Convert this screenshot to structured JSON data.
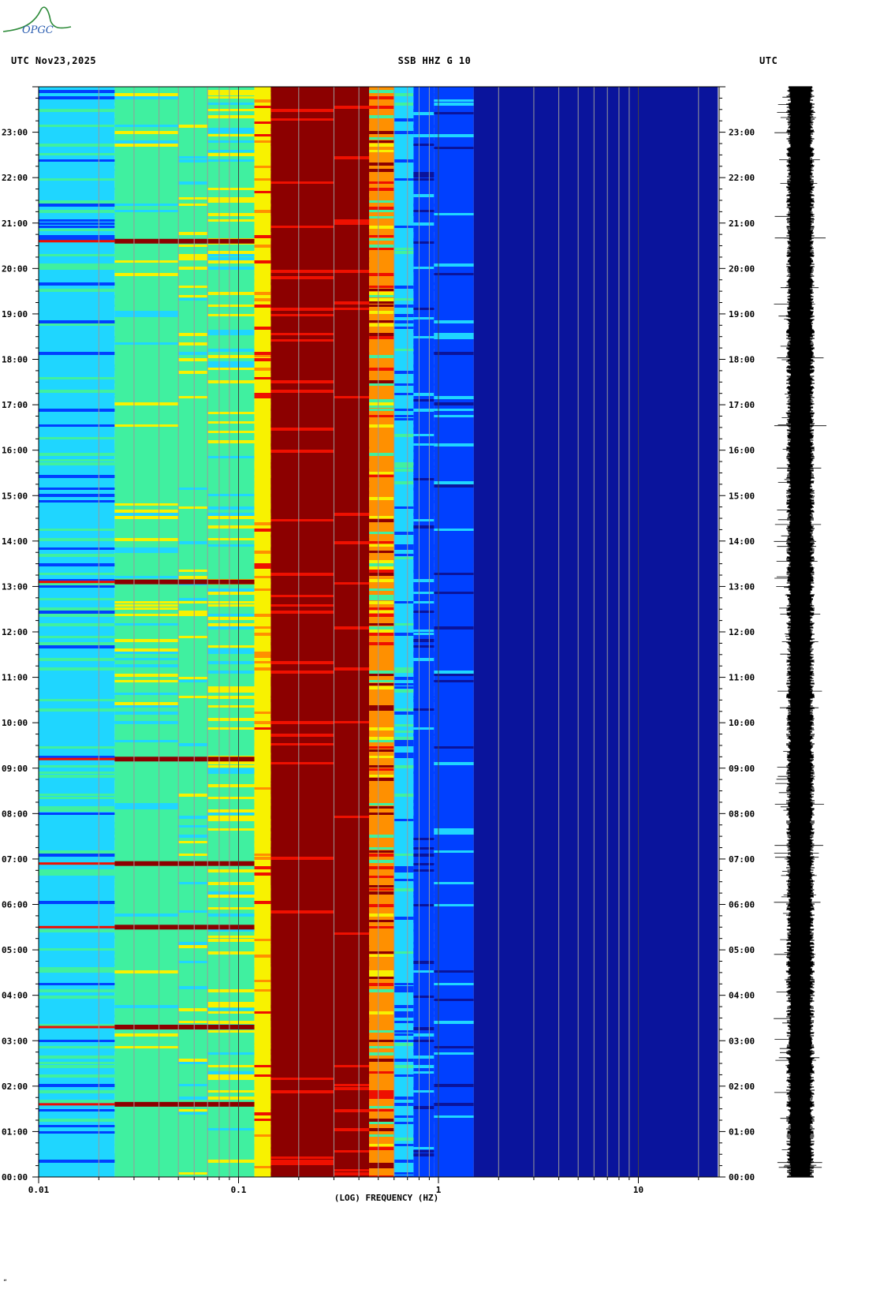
{
  "header": {
    "left": "UTC  Nov23,2025",
    "center": "SSB HHZ G 10",
    "right": "UTC"
  },
  "logo_text": "OPGC",
  "corner_mark": "„",
  "colors": {
    "deep_blue": "#0a149c",
    "blue": "#0040ff",
    "cyan": "#1fd6ff",
    "green": "#40f0a0",
    "yellow": "#f8f200",
    "orange": "#ff9000",
    "red": "#ee1000",
    "dark_red": "#8c0000"
  },
  "chart_data": {
    "type": "heatmap",
    "title": "SSB HHZ G 10",
    "xlabel": "(LOG) FREQUENCY (HZ)",
    "ylabel": "UTC",
    "x_scale": "log",
    "xlim": [
      0.01,
      25
    ],
    "x_ticks": [
      0.01,
      0.1,
      1,
      10
    ],
    "x_tick_labels": [
      "0.01",
      "0.1",
      "1",
      "10"
    ],
    "y_tick_labels": [
      "00:00",
      "01:00",
      "02:00",
      "03:00",
      "04:00",
      "05:00",
      "06:00",
      "07:00",
      "08:00",
      "09:00",
      "10:00",
      "11:00",
      "12:00",
      "13:00",
      "14:00",
      "15:00",
      "16:00",
      "17:00",
      "18:00",
      "19:00",
      "20:00",
      "21:00",
      "22:00",
      "23:00"
    ],
    "ylim_hours": [
      0,
      24
    ],
    "frequency_bands_hz": [
      0.01,
      0.024,
      0.05,
      0.07,
      0.12,
      0.145,
      0.3,
      0.45,
      0.6,
      0.75,
      0.95,
      1.5,
      25
    ],
    "band_levels": [
      "cyan-green",
      "green-yellow",
      "green-yellow",
      "yellow-green",
      "yellow-red",
      "dark-red",
      "dark-red",
      "red-yellow",
      "cyan-blue",
      "blue",
      "blue",
      "deep-blue"
    ],
    "energy_events_hours": [
      9.2,
      3.3,
      5.5,
      1.6,
      13.1,
      20.6,
      6.9
    ],
    "right_panel": "waveform trace"
  }
}
